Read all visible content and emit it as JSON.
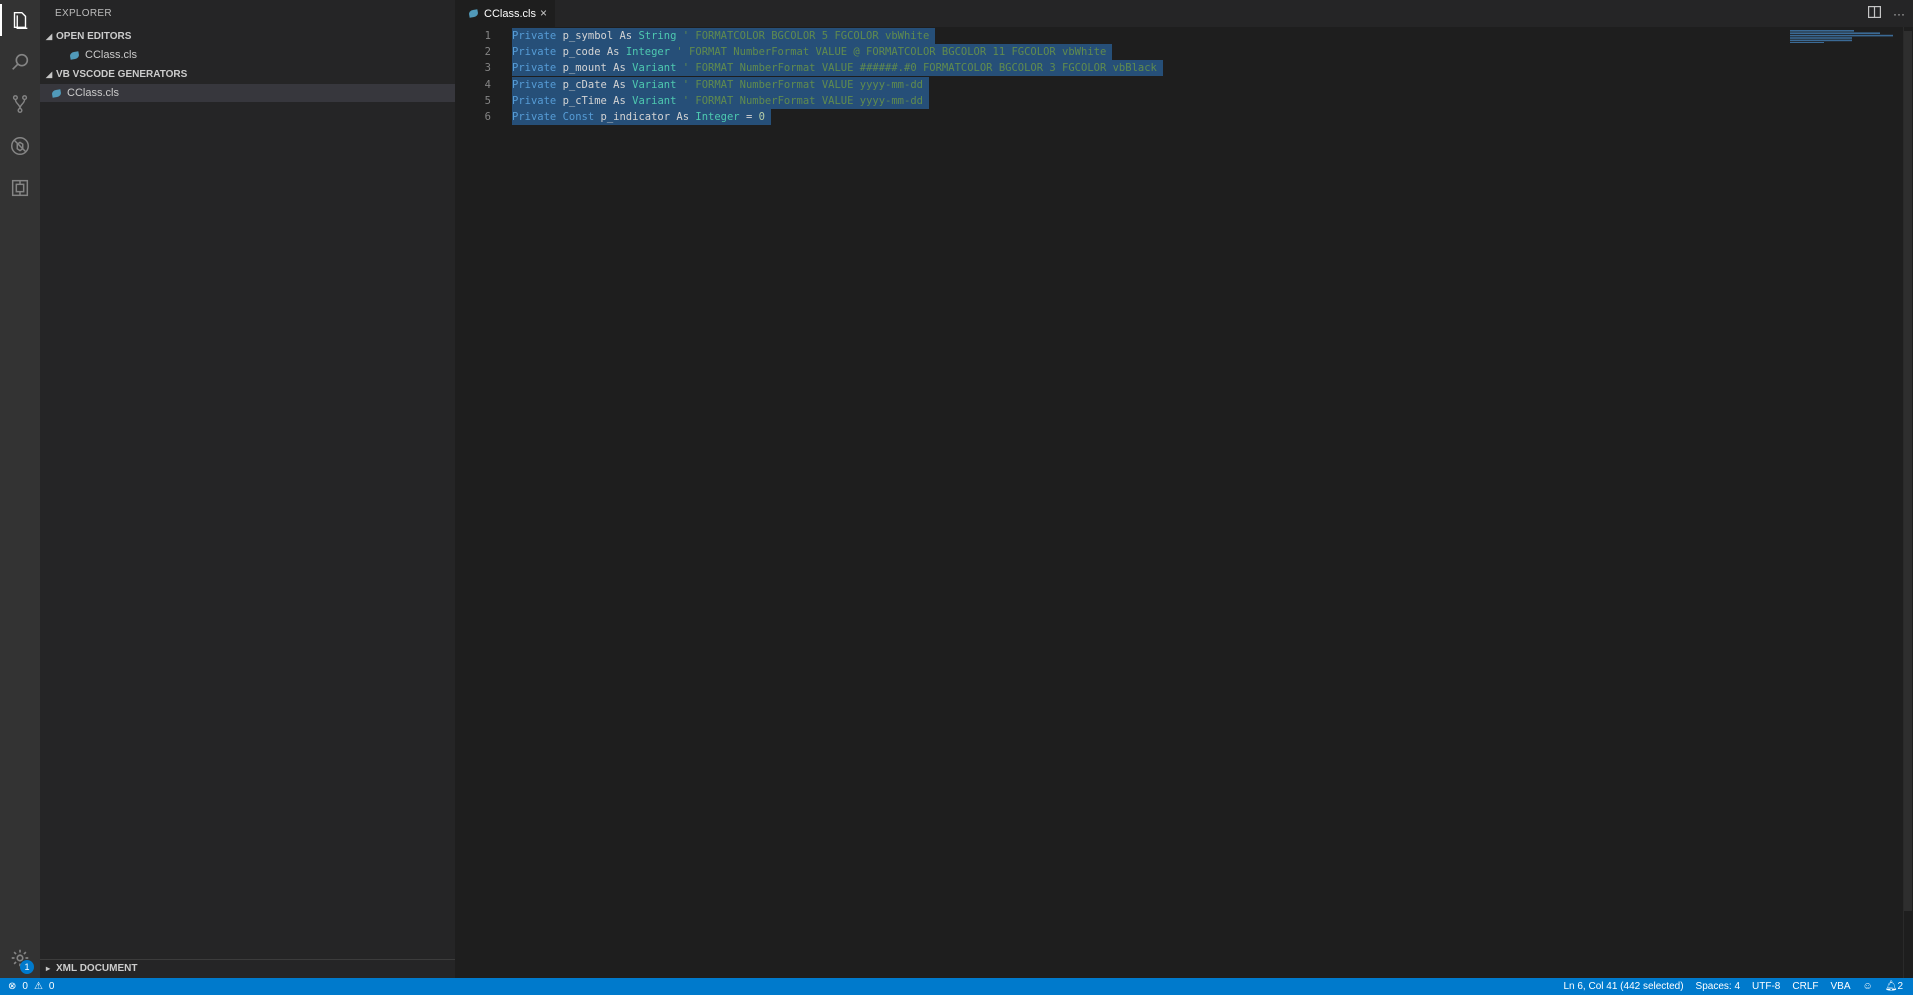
{
  "sidebar": {
    "title": "EXPLORER",
    "open_editors": {
      "label": "OPEN EDITORS",
      "files": [
        "CClass.cls"
      ]
    },
    "folder": {
      "label": "VB VSCODE GENERATORS",
      "files": [
        "CClass.cls"
      ]
    },
    "xml_section": {
      "label": "XML DOCUMENT"
    }
  },
  "activity_bar": {
    "icons": [
      "files-icon",
      "search-icon",
      "source-control-icon",
      "debug-icon",
      "extensions-icon"
    ],
    "settings_badge": "1"
  },
  "tabs": [
    {
      "label": "CClass.cls",
      "close": "×"
    }
  ],
  "editor": {
    "lines": [
      {
        "num": "1",
        "tokens": [
          {
            "t": "Private",
            "c": "kw"
          },
          {
            "t": " p_symbol ",
            "c": "id"
          },
          {
            "t": "As",
            "c": "id"
          },
          {
            "t": " ",
            "c": "id"
          },
          {
            "t": "String",
            "c": "ty"
          },
          {
            "t": " ' FORMATCOLOR BGCOLOR 5 FGCOLOR vbWhite",
            "c": "cm"
          }
        ]
      },
      {
        "num": "2",
        "tokens": [
          {
            "t": "Private",
            "c": "kw"
          },
          {
            "t": " p_code ",
            "c": "id"
          },
          {
            "t": "As",
            "c": "id"
          },
          {
            "t": " ",
            "c": "id"
          },
          {
            "t": "Integer",
            "c": "ty"
          },
          {
            "t": " ' FORMAT NumberFormat VALUE @ FORMATCOLOR BGCOLOR 11 FGCOLOR vbWhite",
            "c": "cm"
          }
        ]
      },
      {
        "num": "3",
        "tokens": [
          {
            "t": "Private",
            "c": "kw"
          },
          {
            "t": " p_mount ",
            "c": "id"
          },
          {
            "t": "As",
            "c": "id"
          },
          {
            "t": " ",
            "c": "id"
          },
          {
            "t": "Variant",
            "c": "ty"
          },
          {
            "t": " ' FORMAT NumberFormat VALUE ######.#0 FORMATCOLOR BGCOLOR 3 FGCOLOR vbBlack",
            "c": "cm"
          }
        ]
      },
      {
        "num": "4",
        "tokens": [
          {
            "t": "Private",
            "c": "kw"
          },
          {
            "t": " p_cDate ",
            "c": "id"
          },
          {
            "t": "As",
            "c": "id"
          },
          {
            "t": " ",
            "c": "id"
          },
          {
            "t": "Variant",
            "c": "ty"
          },
          {
            "t": " ' FORMAT NumberFormat VALUE yyyy-mm-dd",
            "c": "cm"
          }
        ]
      },
      {
        "num": "5",
        "tokens": [
          {
            "t": "Private",
            "c": "kw"
          },
          {
            "t": " p_cTime ",
            "c": "id"
          },
          {
            "t": "As",
            "c": "id"
          },
          {
            "t": " ",
            "c": "id"
          },
          {
            "t": "Variant",
            "c": "ty"
          },
          {
            "t": " ' FORMAT NumberFormat VALUE yyyy-mm-dd",
            "c": "cm"
          }
        ]
      },
      {
        "num": "6",
        "tokens": [
          {
            "t": "Private",
            "c": "kw"
          },
          {
            "t": " ",
            "c": "id"
          },
          {
            "t": "Const",
            "c": "kw"
          },
          {
            "t": " p_indicator ",
            "c": "id"
          },
          {
            "t": "As",
            "c": "id"
          },
          {
            "t": " ",
            "c": "id"
          },
          {
            "t": "Integer",
            "c": "ty"
          },
          {
            "t": " = ",
            "c": "id"
          },
          {
            "t": "0",
            "c": "nm"
          }
        ]
      }
    ]
  },
  "status_bar": {
    "errors": "0",
    "warnings": "0",
    "position": "Ln 6, Col 41 (442 selected)",
    "indent": "Spaces: 4",
    "encoding": "UTF-8",
    "eol": "CRLF",
    "language": "VBA",
    "notifications": "2"
  },
  "colors": {
    "status_bar": "#007acc",
    "selection": "#264f78",
    "keyword": "#569cd6",
    "type": "#4ec9b0",
    "comment": "#608b4e"
  }
}
